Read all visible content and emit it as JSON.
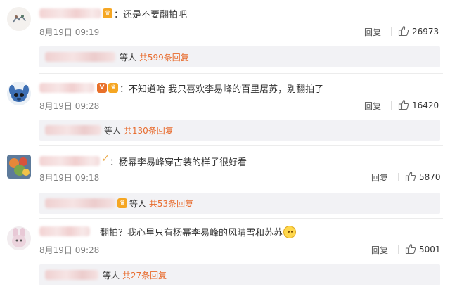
{
  "comments": [
    {
      "text": "：还是不要翻拍吧",
      "date": "8月19日 09:19",
      "reply_label": "回复",
      "likes": "26973",
      "sub_label": "等人",
      "sub_count": "共599条回复"
    },
    {
      "text": "：不知道哈 我只喜欢李易峰的百里屠苏，别翻拍了",
      "date": "8月19日 09:28",
      "reply_label": "回复",
      "likes": "16420",
      "sub_label": "等人",
      "sub_count": "共130条回复"
    },
    {
      "text": "：杨幂李易峰穿古装的样子很好看",
      "date": "8月19日 09:18",
      "reply_label": "回复",
      "likes": "5870",
      "sub_label": "等人",
      "sub_count": "共53条回复"
    },
    {
      "text": "翻拍？我心里只有杨幂李易峰的风晴雪和苏苏",
      "date": "8月19日 09:28",
      "reply_label": "回复",
      "likes": "5001",
      "sub_label": "等人",
      "sub_count": "共27条回复"
    }
  ],
  "badge_text": {
    "v": "V"
  },
  "icons": [
    "avatar",
    "vip-badge-icon",
    "thumb-up-icon",
    "emoji-icon"
  ],
  "colors": {
    "reply_count": "#e86c2e",
    "sub_background": "#f2f2f5",
    "date_gray": "#808080"
  }
}
